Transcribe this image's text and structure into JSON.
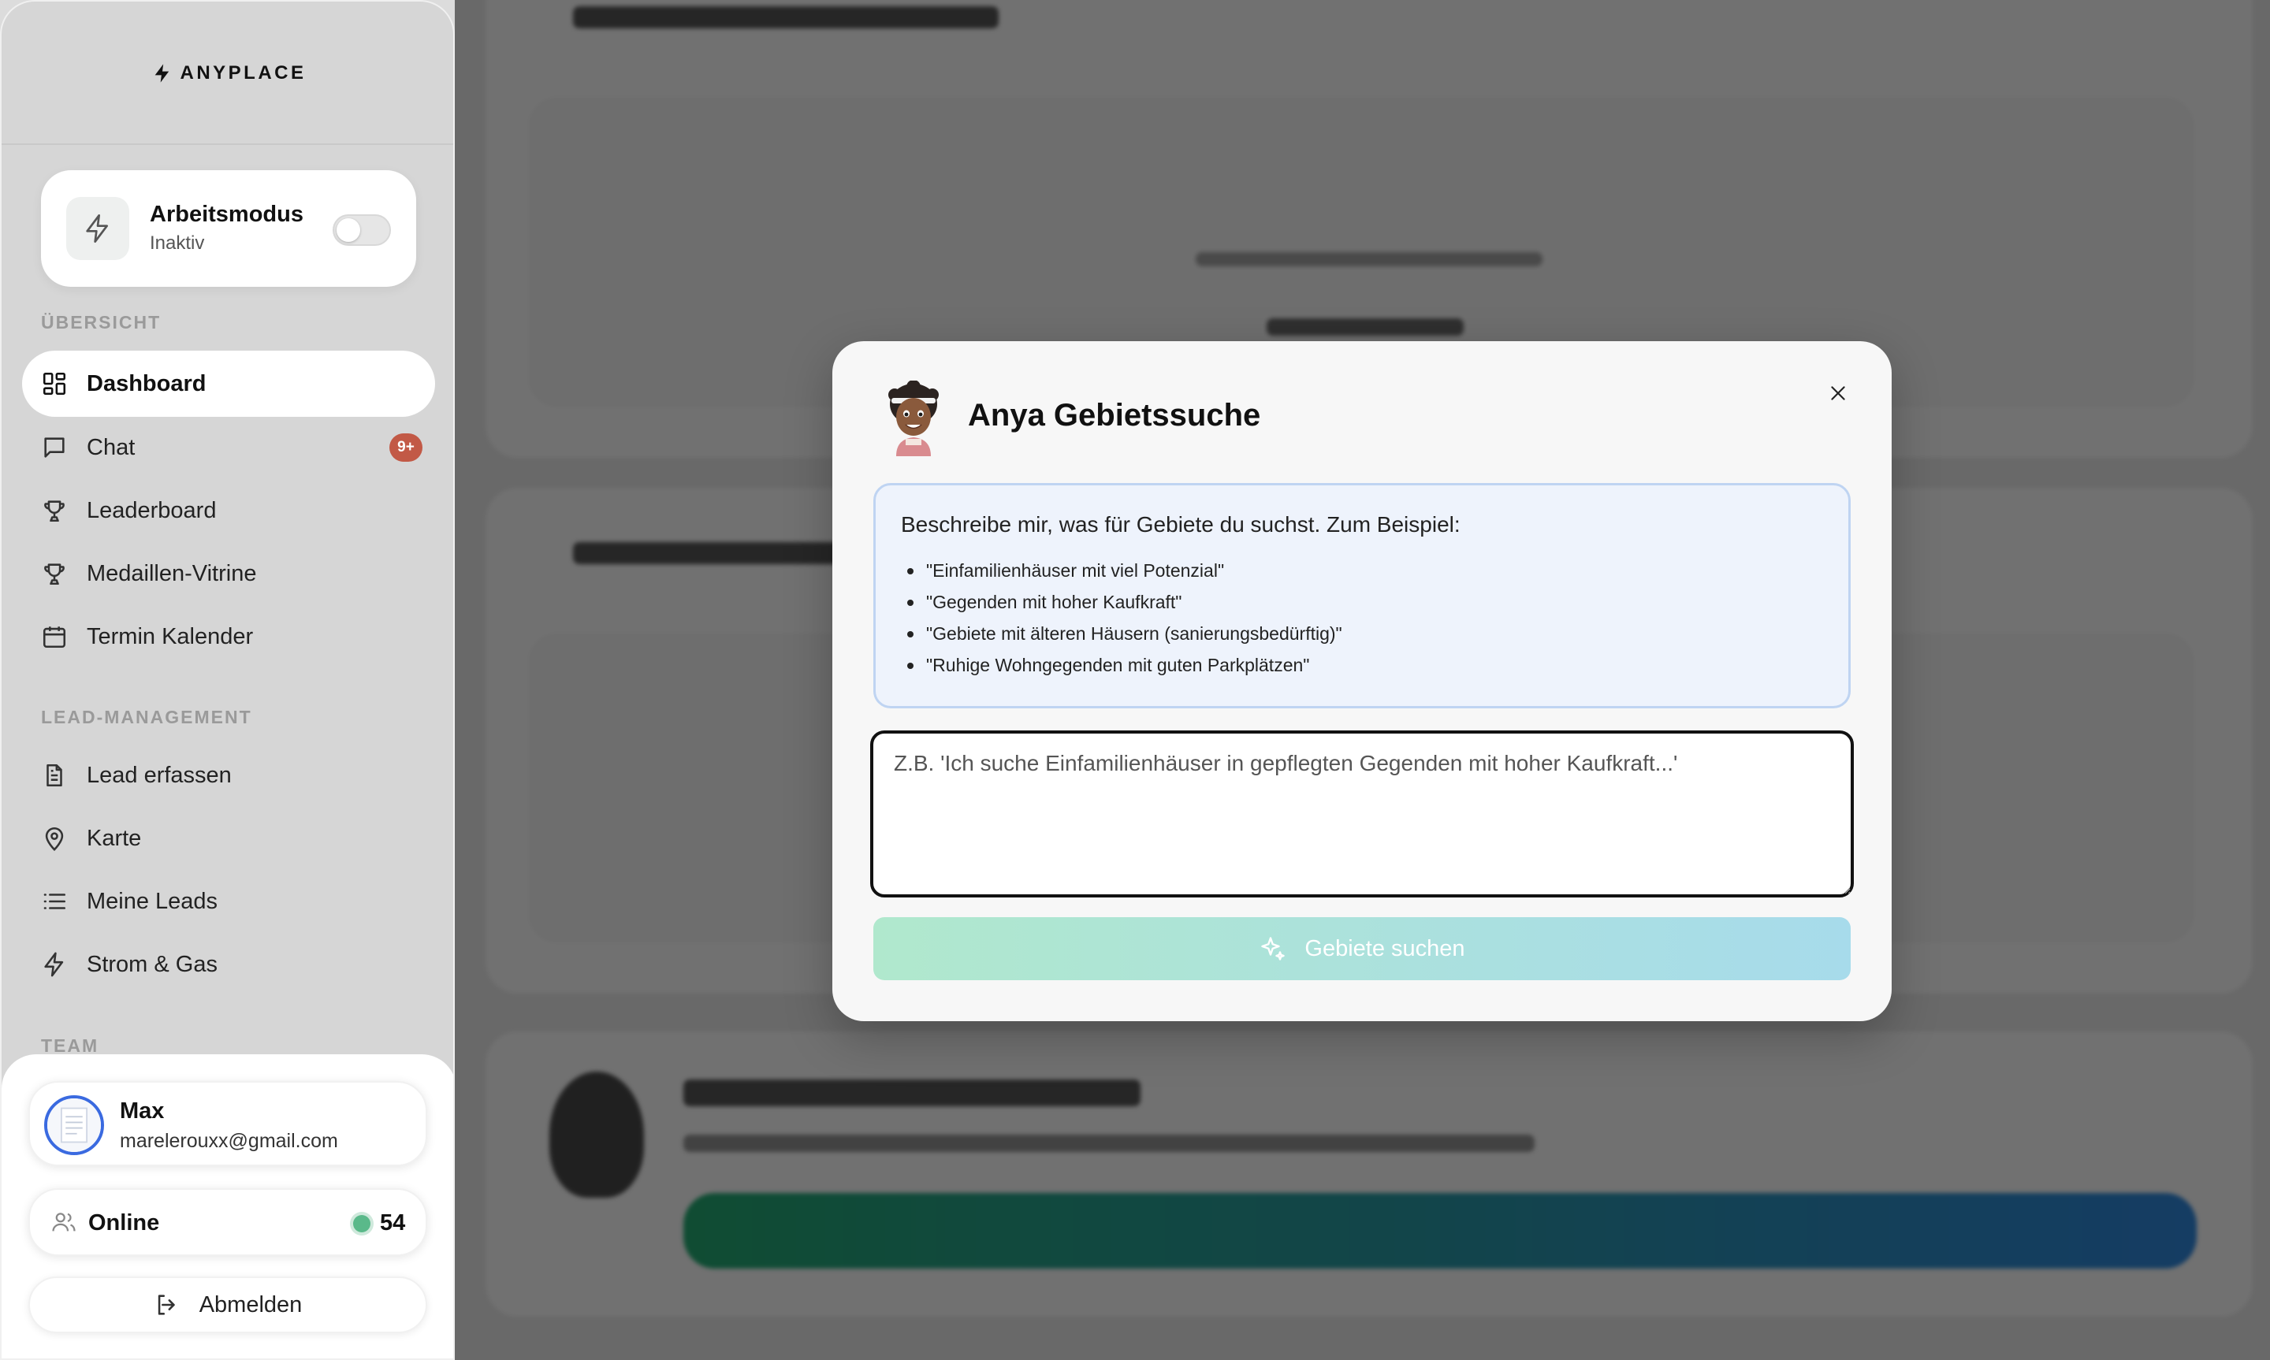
{
  "brand": {
    "name": "ANYPLACE",
    "icon": "lightning-icon"
  },
  "work_mode": {
    "title": "Arbeitsmodus",
    "status": "Inaktiv",
    "enabled": false
  },
  "sidebar": {
    "sections": {
      "overview": "ÜBERSICHT",
      "lead_management": "LEAD-MANAGEMENT",
      "team": "TEAM"
    },
    "overview_items": [
      {
        "label": "Dashboard",
        "icon": "dashboard-icon",
        "active": true
      },
      {
        "label": "Chat",
        "icon": "chat-icon",
        "badge": "9+"
      },
      {
        "label": "Leaderboard",
        "icon": "trophy-icon"
      },
      {
        "label": "Medaillen-Vitrine",
        "icon": "trophy-icon"
      },
      {
        "label": "Termin Kalender",
        "icon": "calendar-icon"
      }
    ],
    "lead_items": [
      {
        "label": "Lead erfassen",
        "icon": "document-icon"
      },
      {
        "label": "Karte",
        "icon": "map-pin-icon"
      },
      {
        "label": "Meine Leads",
        "icon": "list-icon"
      },
      {
        "label": "Strom & Gas",
        "icon": "lightning-icon"
      }
    ]
  },
  "user": {
    "name": "Max",
    "email": "marelerouxx@gmail.com"
  },
  "online": {
    "label": "Online",
    "count": "54",
    "status_color": "#5ab98a"
  },
  "logout": {
    "label": "Abmelden"
  },
  "modal": {
    "title": "Anya Gebietssuche",
    "hint_intro": "Beschreibe mir, was für Gebiete du suchst. Zum Beispiel:",
    "examples": [
      "\"Einfamilienhäuser mit viel Potenzial\"",
      "\"Gegenden mit hoher Kaufkraft\"",
      "\"Gebiete mit älteren Häusern (sanierungsbedürftig)\"",
      "\"Ruhige Wohngegenden mit guten Parkplätzen\""
    ],
    "input_placeholder": "Z.B. 'Ich suche Einfamilienhäuser in gepflegten Gegenden mit hoher Kaufkraft...'",
    "input_value": "",
    "submit_label": "Gebiete suchen"
  },
  "colors": {
    "badge": "#c25946",
    "accent_green": "#22a06b",
    "accent_blue": "#2c7fd0"
  }
}
